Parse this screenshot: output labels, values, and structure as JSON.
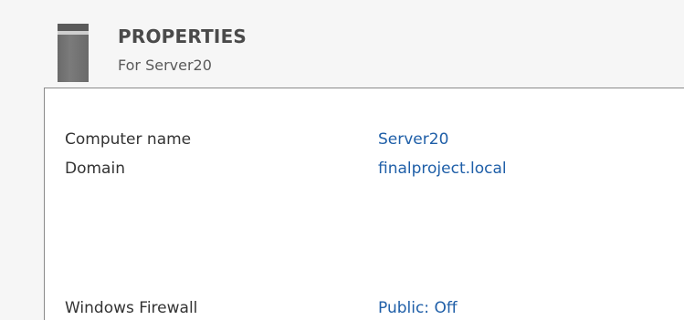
{
  "header": {
    "icon": "server-icon",
    "title": "PROPERTIES",
    "subtitle": "For Server20"
  },
  "properties": [
    {
      "label": "Computer name",
      "value": "Server20"
    },
    {
      "label": "Domain",
      "value": "finalproject.local"
    },
    {
      "label": "Windows Firewall",
      "value": "Public: Off"
    }
  ],
  "colors": {
    "link": "#1f5fa8",
    "label": "#333333",
    "title": "#4a4a4a"
  }
}
